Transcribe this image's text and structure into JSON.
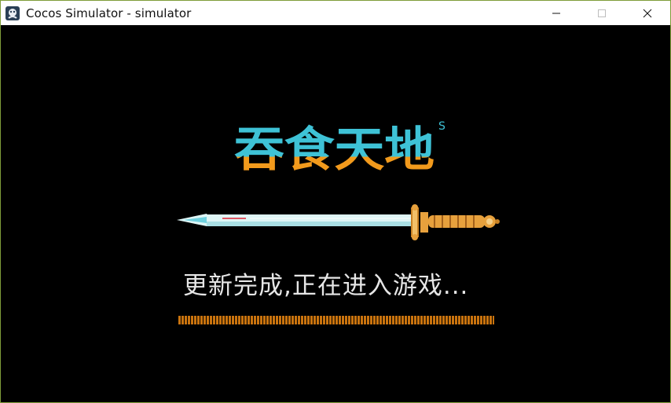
{
  "window": {
    "title": "Cocos Simulator - simulator",
    "icon": "cocos-app-icon",
    "controls": [
      "minimize-icon",
      "maximize-icon",
      "close-icon"
    ]
  },
  "game": {
    "logo_text": "吞食天地",
    "logo_mark": "S",
    "status_text": "更新完成,正在进入游戏...",
    "progress": 1.0,
    "colors": {
      "logo_top": "#3ec2d6",
      "logo_bottom": "#f29a1c",
      "blade": "#dff6f6",
      "hilt": "#e7a13d",
      "progress_bar": "#c9730e",
      "status_text": "#e6e6e6",
      "background": "#000000"
    }
  }
}
